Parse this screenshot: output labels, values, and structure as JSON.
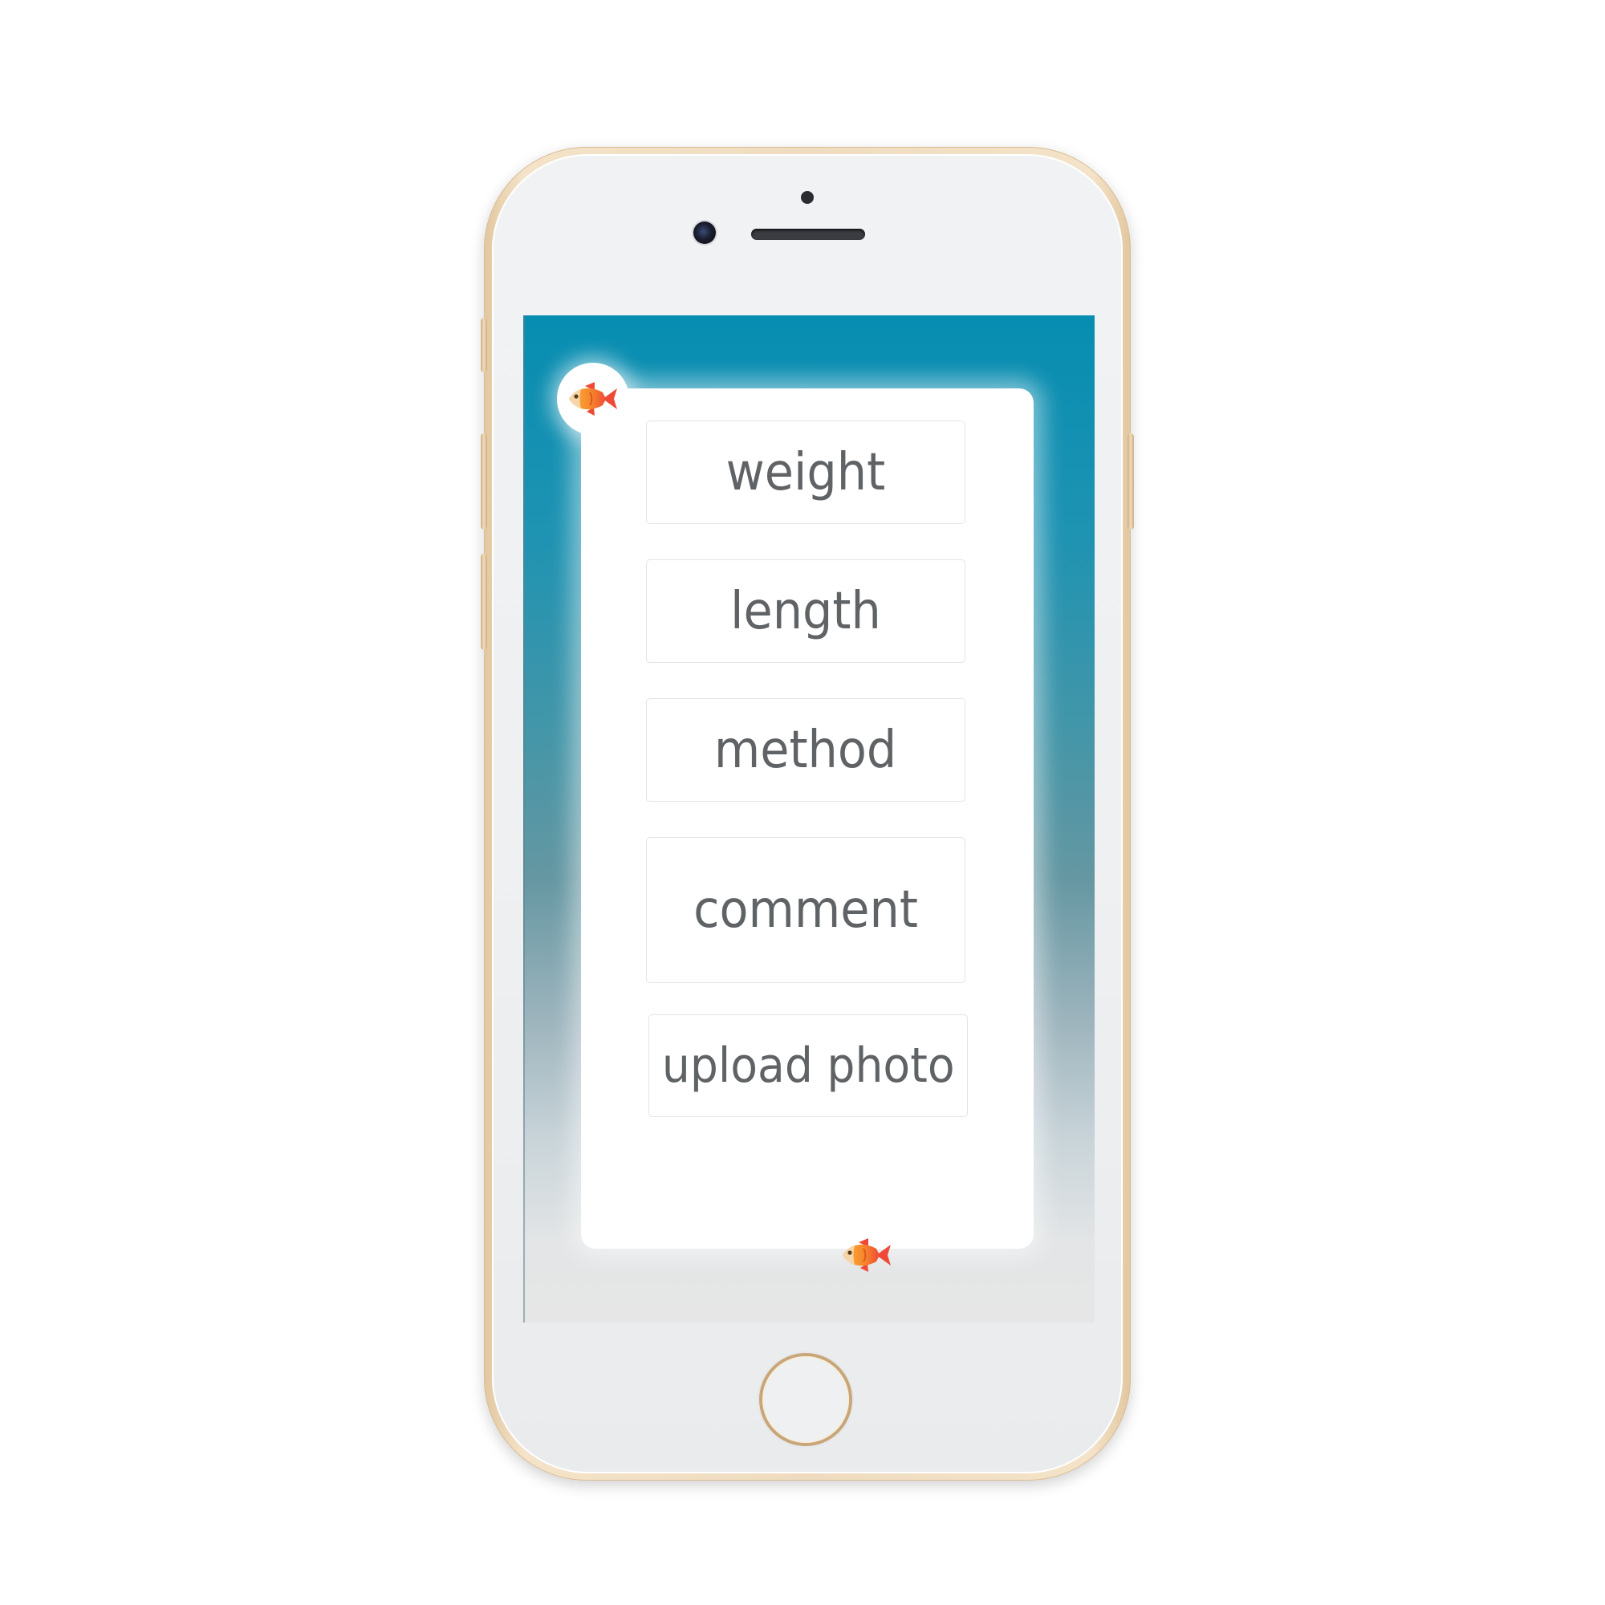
{
  "form": {
    "fields": [
      {
        "label": "weight"
      },
      {
        "label": "length"
      },
      {
        "label": "method"
      },
      {
        "label": "comment"
      },
      {
        "label": "upload photo"
      }
    ]
  },
  "icons": {
    "logo": "fish-icon",
    "footer": "fish-icon"
  },
  "colors": {
    "screen_top": "#068db1",
    "screen_bottom": "#e6e6e6",
    "field_text": "#5f6365",
    "fish_orange": "#f7942b",
    "fish_red": "#ee4a37",
    "phone_gold": "#e9d2ae"
  }
}
